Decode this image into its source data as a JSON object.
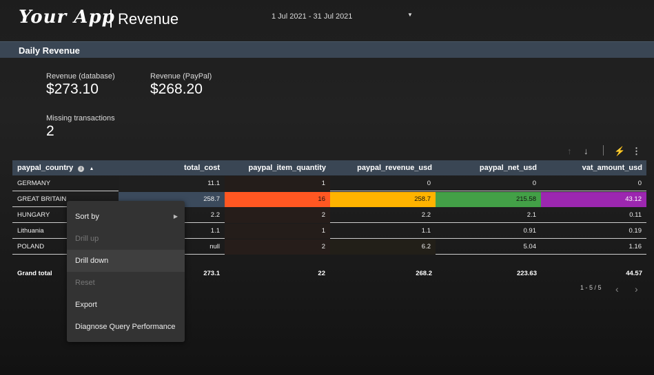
{
  "header": {
    "logo": "Your App",
    "page_title": "Revenue",
    "date_range": "1 Jul 2021 - 31 Jul 2021"
  },
  "section": {
    "title": "Daily Revenue"
  },
  "kpis": [
    {
      "label": "Revenue (database)",
      "value": "$273.10"
    },
    {
      "label": "Revenue (PayPal)",
      "value": "$268.20"
    },
    {
      "label": "Missing transactions",
      "value": "2"
    }
  ],
  "table_toolbar": {
    "icons": [
      "sort-ascending-icon",
      "sort-descending-icon",
      "bolt-icon",
      "more-vert-icon"
    ]
  },
  "table": {
    "columns": [
      "paypal_country",
      "total_cost",
      "paypal_item_quantity",
      "paypal_revenue_usd",
      "paypal_net_usd",
      "vat_amount_usd"
    ],
    "rows": [
      [
        "GERMANY",
        "11.1",
        "1",
        "0",
        "0",
        "0"
      ],
      [
        "GREAT BRITAIN",
        "258.7",
        "16",
        "258.7",
        "215.58",
        "43.12"
      ],
      [
        "HUNGARY",
        "2.2",
        "2",
        "2.2",
        "2.1",
        "0.11"
      ],
      [
        "Lithuania",
        "1.1",
        "1",
        "1.1",
        "0.91",
        "0.19"
      ],
      [
        "POLAND",
        "null",
        "2",
        "6.2",
        "5.04",
        "1.16"
      ]
    ],
    "grand_total": [
      "Grand total",
      "273.1",
      "22",
      "268.2",
      "223.63",
      "44.57"
    ],
    "pagination": "1 - 5 / 5",
    "highlight_colors": {
      "total_cost": "#3b4a5c",
      "paypal_item_quantity": "#ff5722",
      "paypal_revenue_usd": "#ffb300",
      "paypal_net_usd": "#43a047",
      "vat_amount_usd": "#9c27b0"
    }
  },
  "context_menu": {
    "items": [
      {
        "label": "Sort by",
        "enabled": true
      },
      {
        "label": "Drill up",
        "enabled": false
      },
      {
        "label": "Drill down",
        "enabled": true
      },
      {
        "label": "Reset",
        "enabled": false
      },
      {
        "label": "Export",
        "enabled": true
      },
      {
        "label": "Diagnose Query Performance",
        "enabled": true
      }
    ]
  }
}
